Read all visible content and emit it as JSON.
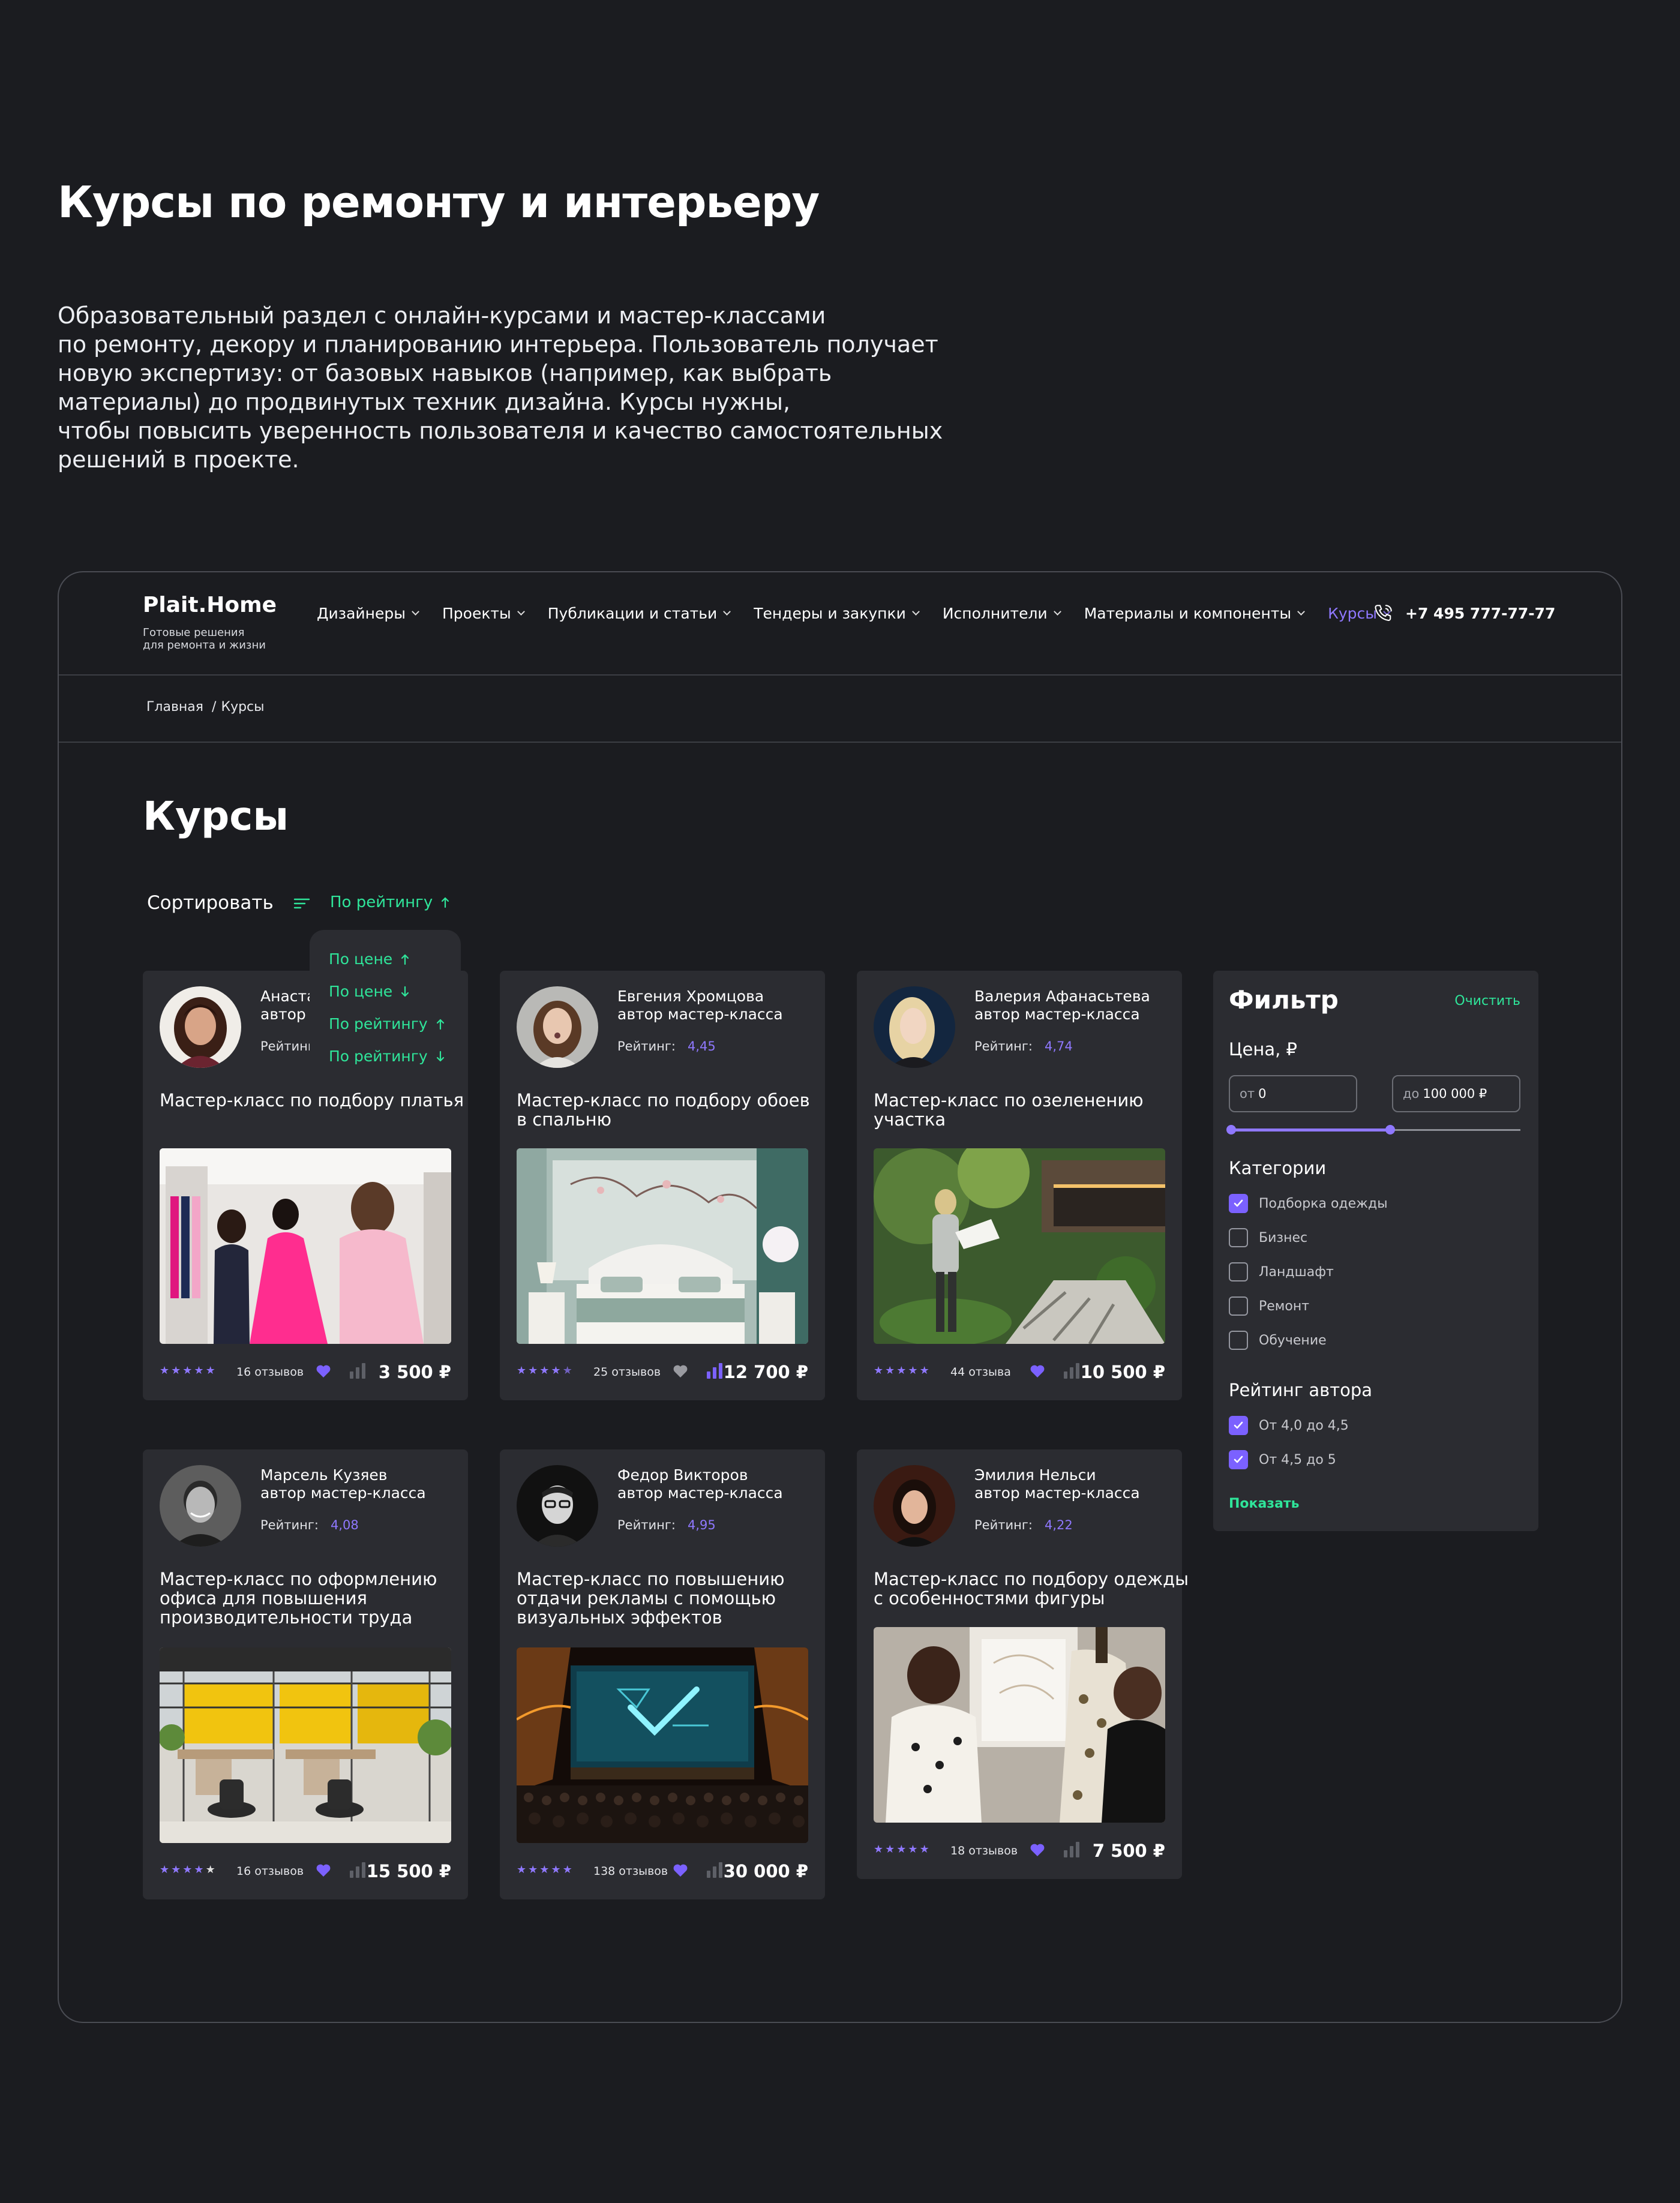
{
  "intro": {
    "title": "Курсы по ремонту и интерьеру",
    "lines": [
      "Образовательный раздел с онлайн-курсами и мастер-классами",
      "по ремонту, декору и планированию интерьера. Пользователь получает",
      "новую экспертизу: от базовых навыков (например, как выбрать",
      "материалы) до продвинутых техник дизайна. Курсы нужны,",
      "чтобы повысить уверенность пользователя и качество самостоятельных",
      "решений в проекте."
    ]
  },
  "header": {
    "logo": "Plait.Home",
    "tagline": [
      "Готовые решения",
      "для ремонта и жизни"
    ],
    "nav": [
      {
        "label": "Дизайнеры"
      },
      {
        "label": "Проекты"
      },
      {
        "label": "Публикации и статьи"
      },
      {
        "label": "Тендеры и закупки"
      },
      {
        "label": "Исполнители"
      },
      {
        "label": "Материалы и компоненты"
      },
      {
        "label": "Курсы",
        "active": true
      }
    ],
    "phone": "+7 495 777-77-77"
  },
  "breadcrumbs": [
    "Главная",
    "Курсы"
  ],
  "page": {
    "title": "Курсы",
    "sort_label": "Сортировать",
    "sort_current": "По рейтингу"
  },
  "sort_options": [
    {
      "label": "По цене",
      "dir": "up"
    },
    {
      "label": "По цене",
      "dir": "down"
    },
    {
      "label": "По рейтингу",
      "dir": "up"
    },
    {
      "label": "По рейтингу",
      "dir": "down"
    }
  ],
  "rating_label": "Рейтинг:",
  "cards": [
    {
      "author": "Анаста",
      "role": "автор м",
      "rating": "",
      "title": [
        "Мастер-класс по подбору платья"
      ],
      "stars": 5,
      "reviews": "16 отзывов",
      "liked": true,
      "compared": false,
      "price": "3 500 ₽"
    },
    {
      "author": "Евгения Хромцова",
      "role": "автор мастер-класса",
      "rating": "4,45",
      "title": [
        "Мастер-класс по подбору обоев",
        "в спальню"
      ],
      "stars": 4.5,
      "reviews": "25 отзывов",
      "liked": false,
      "compared": true,
      "price": "12 700 ₽"
    },
    {
      "author": "Валерия Афанасьтева",
      "role": "автор мастер-класса",
      "rating": "4,74",
      "title": [
        "Мастер-класс по озеленению",
        "участка"
      ],
      "stars": 5,
      "reviews": "44 отзыва",
      "liked": true,
      "compared": false,
      "price": "10 500 ₽"
    },
    {
      "author": "Марсель Кузяев",
      "role": "автор мастер-класса",
      "rating": "4,08",
      "title": [
        "Мастер-класс по оформлению",
        "офиса для повышения",
        "производительности труда"
      ],
      "stars": 4,
      "reviews": "16 отзывов",
      "liked": true,
      "compared": false,
      "price": "15 500 ₽"
    },
    {
      "author": "Федор Викторов",
      "role": "автор мастер-класса",
      "rating": "4,95",
      "title": [
        "Мастер-класс по повышению",
        "отдачи рекламы с помощью",
        "визуальных эффектов"
      ],
      "stars": 5,
      "reviews": "138 отзывов",
      "liked": true,
      "compared": false,
      "price": "30 000 ₽"
    },
    {
      "author": "Эмилия Нельси",
      "role": "автор мастер-класса",
      "rating": "4,22",
      "title": [
        "Мастер-класс по подбору одежды",
        "с особенностями фигуры"
      ],
      "stars": 5,
      "reviews": "18 отзывов",
      "liked": true,
      "compared": false,
      "price": "7 500 ₽"
    }
  ],
  "filter": {
    "title": "Фильтр",
    "clear": "Очистить",
    "price_label": "Цена, ₽",
    "from_prefix": "от",
    "from_value": "0",
    "to_prefix": "до",
    "to_value": "100 000 ₽",
    "price_range": {
      "min": 0,
      "max": 100000,
      "from": 0,
      "to": 55000
    },
    "categories_label": "Категории",
    "categories": [
      {
        "label": "Подборка одежды",
        "checked": true
      },
      {
        "label": "Бизнес",
        "checked": false
      },
      {
        "label": "Ландшафт",
        "checked": false
      },
      {
        "label": "Ремонт",
        "checked": false
      },
      {
        "label": "Обучение",
        "checked": false
      }
    ],
    "rating_label": "Рейтинг автора",
    "ratings": [
      {
        "label": "От 4,0 до 4,5",
        "checked": true
      },
      {
        "label": "От 4,5 до 5",
        "checked": true
      }
    ],
    "show": "Показать"
  },
  "colors": {
    "accent": "#7b61ff",
    "accent_text": "#8f78ff",
    "green": "#2fe59a",
    "bg": "#1b1c20",
    "card": "#2b2c31"
  }
}
